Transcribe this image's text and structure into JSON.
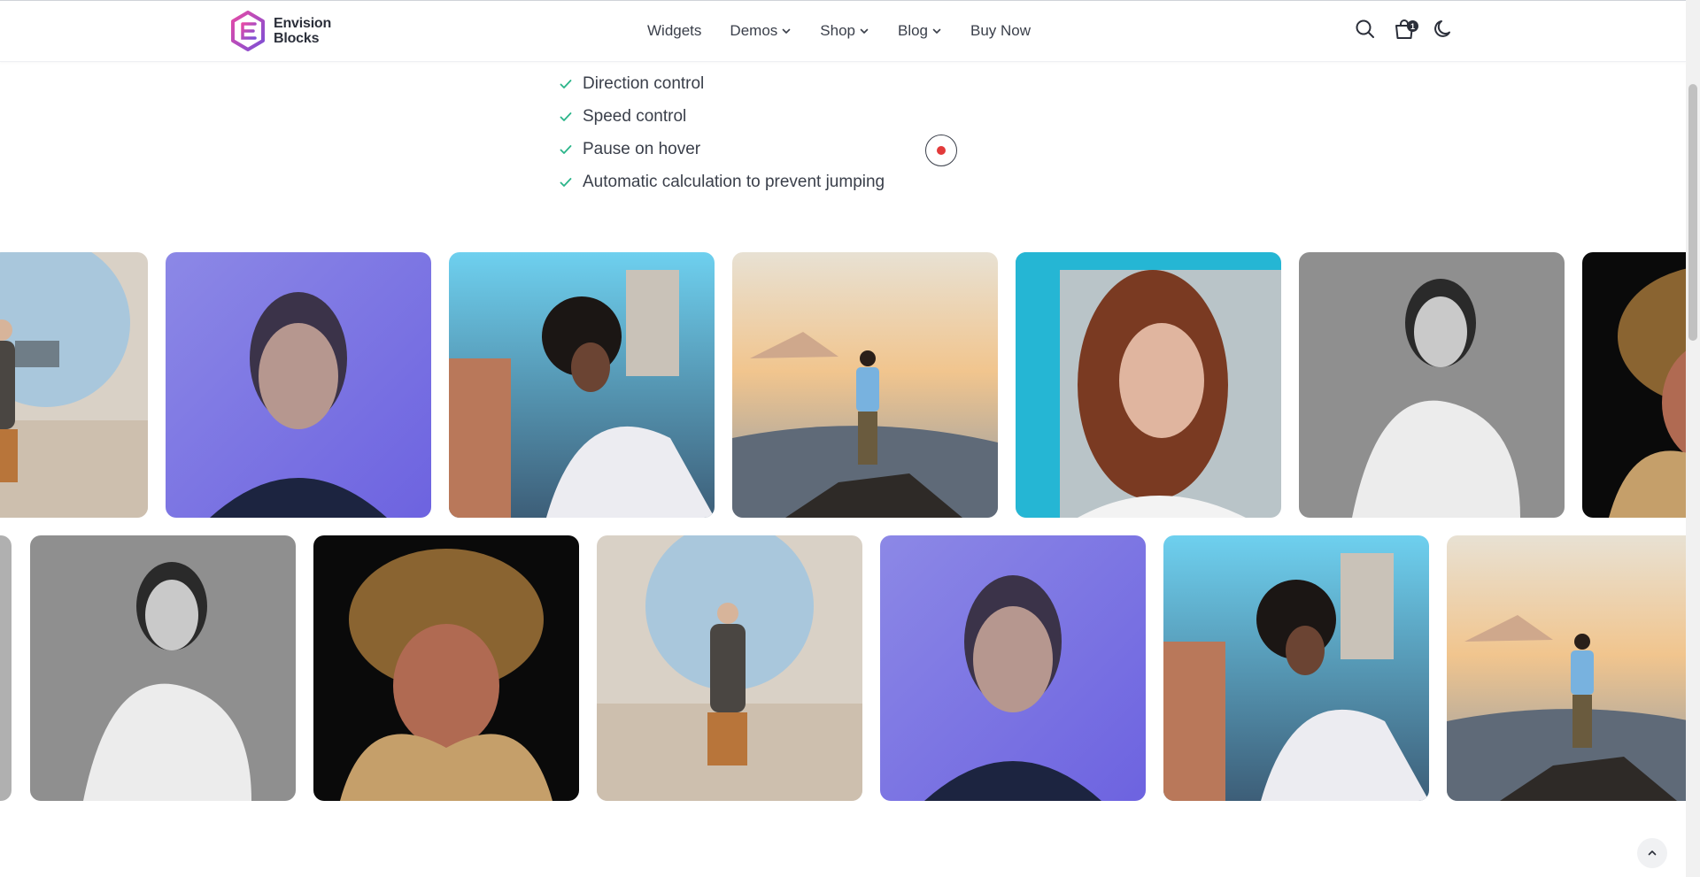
{
  "header": {
    "logo": {
      "line1": "Envision",
      "line2": "Blocks"
    },
    "nav": [
      {
        "label": "Widgets",
        "dropdown": false
      },
      {
        "label": "Demos",
        "dropdown": true
      },
      {
        "label": "Shop",
        "dropdown": true
      },
      {
        "label": "Blog",
        "dropdown": true
      },
      {
        "label": "Buy Now",
        "dropdown": false
      }
    ],
    "icons": [
      "search-icon",
      "cart-icon",
      "moon-icon"
    ],
    "cart_count": "1"
  },
  "features": [
    "Direction control",
    "Speed control",
    "Pause on hover",
    "Automatic calculation to prevent jumping"
  ],
  "colors": {
    "check": "#2bb58a",
    "record_dot": "#e23a3a",
    "logo_gradient": [
      "#e64aa6",
      "#7b4fd6"
    ]
  },
  "gallery": {
    "row1": [
      "man-sitting-wall-circle",
      "woman-blue-light-portrait",
      "woman-curly-hair-city",
      "man-mountain-sunset",
      "woman-red-hair-turquoise",
      "woman-bw-portrait",
      "woman-fur-hat"
    ],
    "row2": [
      "partial-tile",
      "woman-bw-portrait",
      "woman-fur-hat",
      "man-sitting-wall-circle",
      "woman-blue-light-portrait",
      "woman-curly-hair-city",
      "man-mountain-sunset"
    ]
  }
}
